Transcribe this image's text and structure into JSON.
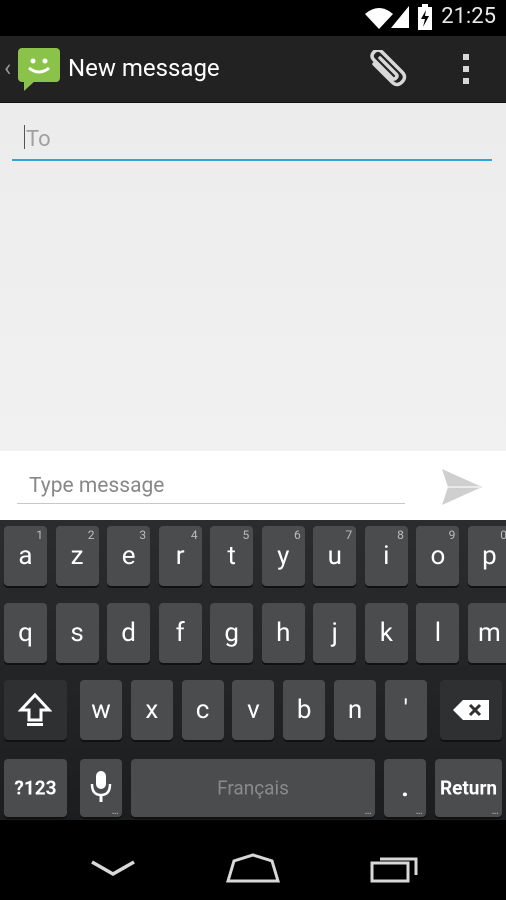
{
  "status_bar": {
    "time": "21:25"
  },
  "action_bar": {
    "title": "New message"
  },
  "recipient": {
    "placeholder": "To",
    "value": ""
  },
  "compose": {
    "placeholder": "Type message",
    "value": ""
  },
  "keyboard": {
    "rows": [
      [
        {
          "k": "a",
          "h": "1"
        },
        {
          "k": "z",
          "h": "2"
        },
        {
          "k": "e",
          "h": "3"
        },
        {
          "k": "r",
          "h": "4"
        },
        {
          "k": "t",
          "h": "5"
        },
        {
          "k": "y",
          "h": "6"
        },
        {
          "k": "u",
          "h": "7"
        },
        {
          "k": "i",
          "h": "8"
        },
        {
          "k": "o",
          "h": "9"
        },
        {
          "k": "p",
          "h": "0"
        }
      ],
      [
        {
          "k": "q"
        },
        {
          "k": "s"
        },
        {
          "k": "d"
        },
        {
          "k": "f"
        },
        {
          "k": "g"
        },
        {
          "k": "h"
        },
        {
          "k": "j"
        },
        {
          "k": "k"
        },
        {
          "k": "l"
        },
        {
          "k": "m"
        }
      ],
      [
        {
          "k": "w"
        },
        {
          "k": "x"
        },
        {
          "k": "c"
        },
        {
          "k": "v"
        },
        {
          "k": "b"
        },
        {
          "k": "n"
        },
        {
          "k": "'"
        }
      ]
    ],
    "symbols_label": "?123",
    "space_label": "Français",
    "period_label": ".",
    "return_label": "Return",
    "more_dots": "..."
  },
  "icons": {
    "signal": "cell-signal-icon",
    "wifi": "wifi-icon",
    "battery": "battery-charging-icon",
    "attach": "paperclip-icon",
    "overflow": "overflow-menu-icon",
    "send": "send-icon",
    "shift": "shift-icon",
    "delete": "backspace-icon",
    "mic": "microphone-icon"
  },
  "colors": {
    "accent": "#33a3dc",
    "app_green": "#8bc34a"
  }
}
